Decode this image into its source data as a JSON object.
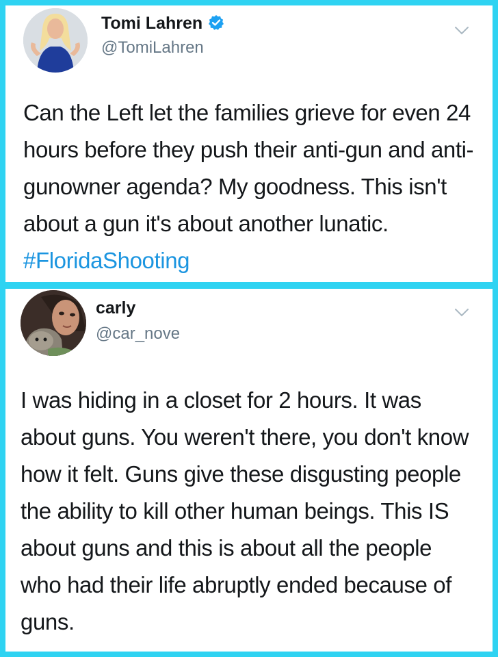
{
  "tweets": [
    {
      "name": "Tomi Lahren",
      "handle": "@TomiLahren",
      "verified": true,
      "text": "Can the Left let the families grieve for even 24 hours before they push their anti-gun and anti-gunowner agenda? My goodness. This isn't about a gun it's about another lunatic. ",
      "hashtag": "#FloridaShooting",
      "avatar_icon": "profile-photo"
    },
    {
      "name": "carly",
      "handle": "@car_nove",
      "verified": false,
      "text": "I was hiding in a closet for 2 hours. It was about guns. You weren't there, you don't know how it felt. Guns give these disgusting people the ability to kill other human beings. This IS about guns and this is about all the people who had their life abruptly ended because of guns.",
      "avatar_icon": "profile-photo"
    }
  ],
  "colors": {
    "background": "#2fd3f2",
    "card": "#ffffff",
    "text": "#14171a",
    "secondary": "#657786",
    "link": "#1b95e0",
    "verified_badge": "#1da1f2"
  }
}
